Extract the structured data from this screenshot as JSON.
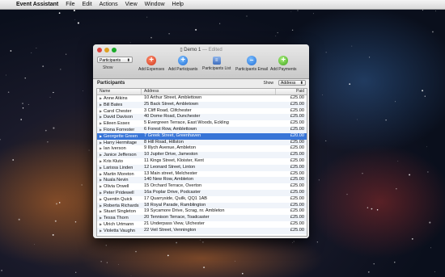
{
  "menubar": {
    "app_name": "Event Assistant",
    "menus": [
      "File",
      "Edit",
      "Actions",
      "View",
      "Window",
      "Help"
    ]
  },
  "window": {
    "title": "Demo 1",
    "title_suffix": "— Edited",
    "toolbar": {
      "show_select_value": "Participants",
      "show_label": "Show",
      "buttons": [
        {
          "label": "Add Expenses",
          "icon": "plus-icon"
        },
        {
          "label": "Add Participants",
          "icon": "plus-icon"
        },
        {
          "label": "Participants List",
          "icon": "list-icon"
        },
        {
          "label": "Participants Email",
          "icon": "email-icon"
        },
        {
          "label": "Add Payments",
          "icon": "plus-icon"
        }
      ]
    },
    "section_title": "Participants",
    "show_label": "Show",
    "show_value": "Address",
    "columns": {
      "name": "Name",
      "address": "Address",
      "paid": "Paid"
    },
    "rows": [
      {
        "name": "Anne Atkins",
        "address": "10 Arthur Street, Amblettown",
        "paid": "£25.00"
      },
      {
        "name": "Bill Bates",
        "address": "25 Back Street, Ambletown",
        "paid": "£25.00"
      },
      {
        "name": "Carol Chester",
        "address": "3 Cliff Road, Clifchester",
        "paid": "£25.00"
      },
      {
        "name": "David Davison",
        "address": "40 Dome Road, Dunchester",
        "paid": "£25.00"
      },
      {
        "name": "Eileen Essex",
        "address": "5 Evergreen Terrace, East Woods, Eckling",
        "paid": "£25.00"
      },
      {
        "name": "Fiona Forrester",
        "address": "6 Forest Row, Amblettown",
        "paid": "£25.00"
      },
      {
        "name": "Georgette Green",
        "address": "7 Greek Street, Greenhaven",
        "paid": "£20.00",
        "selected": true
      },
      {
        "name": "Harry Hermitage",
        "address": "8 Hill Road, Hillston",
        "paid": "£25.00"
      },
      {
        "name": "Ian Iverson",
        "address": "9 Illych Avenue, Ambleton",
        "paid": "£25.00"
      },
      {
        "name": "Janice Jefferson",
        "address": "10 Jupiter Drive, Jameston",
        "paid": "£25.00"
      },
      {
        "name": "Kris Kluto",
        "address": "11 Kings Street, Kloister, Kent",
        "paid": "£25.00"
      },
      {
        "name": "Larissa Linden",
        "address": "12 Leonard Street, Linton",
        "paid": "£25.00"
      },
      {
        "name": "Martin Moreton",
        "address": "13 Main street, Melchester",
        "paid": "£25.00"
      },
      {
        "name": "Nuala Nevin",
        "address": "140 New Row, Ambleton",
        "paid": "£25.00"
      },
      {
        "name": "Olivia Orwell",
        "address": "15 Orchard Terrace, Overton",
        "paid": "£25.00"
      },
      {
        "name": "Peter Pridewell",
        "address": "16a Poplar Drive, Podcaster",
        "paid": "£25.00"
      },
      {
        "name": "Quentin Quick",
        "address": "17 Quarryside, Quilk, QQ1 1AB",
        "paid": "£25.00"
      },
      {
        "name": "Roberta Richards",
        "address": "18 Royal Parade, Ramblington",
        "paid": "£25.00"
      },
      {
        "name": "Stuart Singleton",
        "address": "19 Sycamore Drive, Scrag, nr. Ambleton",
        "paid": "£25.00"
      },
      {
        "name": "Tessa Thorn",
        "address": "20 Tennison Terrace, Toadcaster",
        "paid": "£25.00"
      },
      {
        "name": "Ulrich Urtmann",
        "address": "21 Underpass View, Ulchester",
        "paid": "£25.00"
      },
      {
        "name": "Violetta Vaughn",
        "address": "22 Veil Street, Vennington",
        "paid": "£25.00"
      }
    ]
  }
}
